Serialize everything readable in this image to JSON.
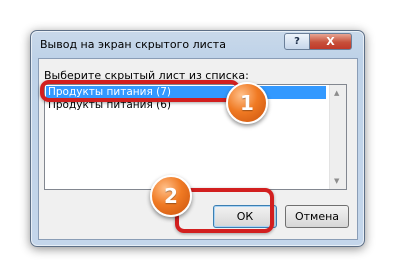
{
  "dialog": {
    "title": "Вывод на экран скрытого листа",
    "help_label": "?",
    "close_label": "X",
    "prompt": "Выберите скрытый лист из списка:",
    "list_items": [
      {
        "label": "Продукты питания (7)",
        "selected": true
      },
      {
        "label": "Продукты питания (6)",
        "selected": false
      }
    ],
    "scroll_up_glyph": "▲",
    "scroll_down_glyph": "▼",
    "ok_label": "ОК",
    "cancel_label": "Отмена"
  },
  "annotations": {
    "badge_1": "1",
    "badge_2": "2",
    "frame_color": "#d21f1f",
    "badge_color": "#f07a23"
  }
}
